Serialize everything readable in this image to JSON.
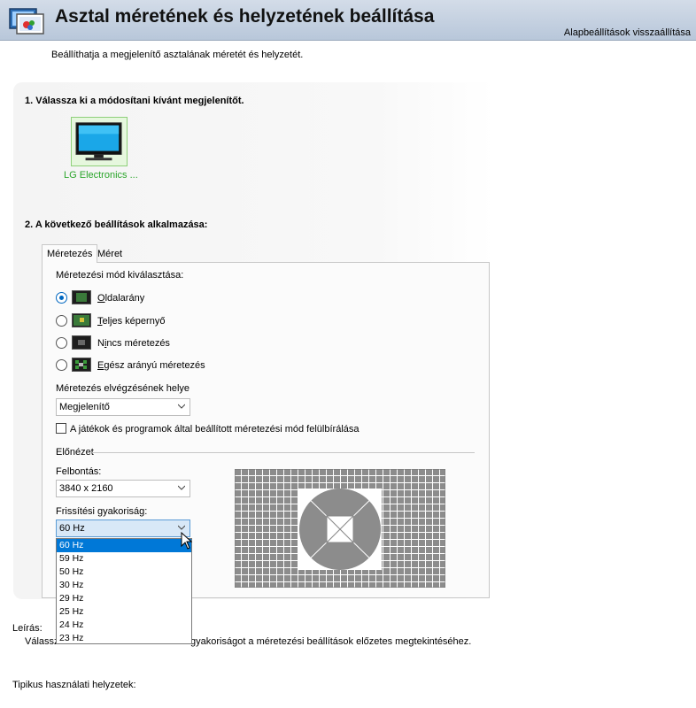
{
  "header": {
    "title": "Asztal méretének és helyzetének beállítása",
    "restore_link": "Alapbeállítások visszaállítása"
  },
  "intro": "Beállíthatja a megjelenítő asztalának méretét és helyzetét.",
  "step1": {
    "heading": "1. Válassza ki a módosítani kívánt megjelenítőt.",
    "monitor_label": "LG Electronics ..."
  },
  "step2": {
    "heading": "2. A következő beállítások alkalmazása:"
  },
  "tabs": [
    {
      "label": "Méretezés",
      "active": true
    },
    {
      "label": "Méret",
      "active": false
    }
  ],
  "scaling": {
    "mode_label": "Méretezési mód kiválasztása:",
    "modes": [
      {
        "accel": "O",
        "rest": "ldalarány",
        "checked": true
      },
      {
        "accel": "T",
        "rest": "eljes képernyő",
        "checked": false
      },
      {
        "prefix": "N",
        "accel": "i",
        "rest": "ncs méretezés",
        "checked": false
      },
      {
        "accel": "E",
        "rest": "gész arányú méretezés",
        "checked": false
      }
    ],
    "location_label": "Méretezés elvégzésének helye",
    "location_value": "Megjelenítő",
    "override_label": "A játékok és programok által beállított méretezési mód felülbírálása"
  },
  "preview": {
    "section_label": "Előnézet",
    "resolution_label": "Felbontás:",
    "resolution_value": "3840 x 2160",
    "refresh_label": "Frissítési gyakoriság:",
    "refresh_value": "60 Hz",
    "refresh_options": [
      "60 Hz",
      "59 Hz",
      "50 Hz",
      "30 Hz",
      "29 Hz",
      "25 Hz",
      "24 Hz",
      "23 Hz"
    ]
  },
  "description": {
    "label": "Leírás:",
    "text_left": "Válassza",
    "text_right": "gyakoriságot a méretezési beállítások előzetes megtekintéséhez."
  },
  "typical": {
    "label": "Tipikus használati helyzetek:"
  },
  "colors": {
    "header_bg": "#c4d1e2",
    "accent": "#0078d7",
    "monitor_label": "#2aa52a",
    "preview_gray": "#8c8c8c"
  }
}
